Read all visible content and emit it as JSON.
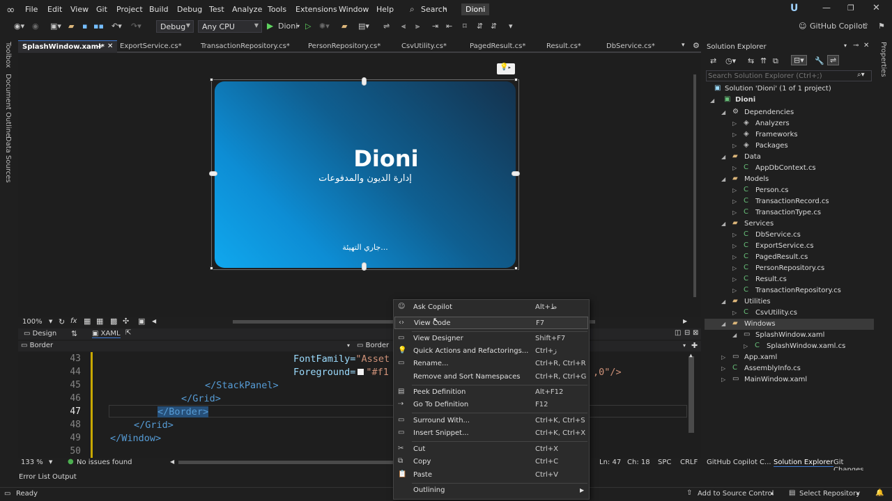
{
  "menu": {
    "items": [
      "File",
      "Edit",
      "View",
      "Git",
      "Project",
      "Build",
      "Debug",
      "Test",
      "Analyze",
      "Tools",
      "Extensions",
      "Window",
      "Help"
    ],
    "search": "Search",
    "solution_name": "Dioni"
  },
  "toolbar": {
    "config": "Debug",
    "platform": "Any CPU",
    "run_target": "Dioni",
    "copilot": "GitHub Copilot"
  },
  "left_rail": [
    "Toolbox",
    "Document Outline",
    "Data Sources"
  ],
  "right_rail": [
    "Properties"
  ],
  "doc_tabs": [
    "SplashWindow.xaml*",
    "ExportService.cs*",
    "TransactionRepository.cs*",
    "PersonRepository.cs*",
    "CsvUtility.cs*",
    "PagedResult.cs*",
    "Result.cs*",
    "DbService.cs*"
  ],
  "splash": {
    "title": "Dioni",
    "subtitle": "إدارة الديون والمدفوعات",
    "loading": "جاري التهيئة..."
  },
  "designer_bar": {
    "zoom": "100%",
    "design_tab": "Design",
    "xaml_tab": "XAML",
    "nav_left": "Border",
    "nav_right": "Border"
  },
  "code": {
    "lines": [
      {
        "num": "43",
        "text_a": "FontFamily=",
        "text_b": "\"Asset"
      },
      {
        "num": "44",
        "text_a": "Foreground=",
        "text_b": "\"#f1"
      },
      {
        "num": "45",
        "text": "</StackPanel>"
      },
      {
        "num": "46",
        "text": "</Grid>"
      },
      {
        "num": "47",
        "text": "</Border>"
      },
      {
        "num": "48",
        "text": "</Grid>"
      },
      {
        "num": "49",
        "text": "</Window>"
      },
      {
        "num": "50",
        "text": ""
      }
    ],
    "tail": ",0\"/>"
  },
  "code_status": {
    "zoom": "133 %",
    "issues": "No issues found",
    "ln": "Ln: 47",
    "ch": "Ch: 18",
    "spc": "SPC",
    "crlf": "CRLF"
  },
  "solution_explorer": {
    "title": "Solution Explorer",
    "search_placeholder": "Search Solution Explorer (Ctrl+;)",
    "solution": "Solution 'Dioni' (1 of 1 project)",
    "project": "Dioni",
    "items": [
      {
        "label": "Dependencies",
        "indent": 2
      },
      {
        "label": "Analyzers",
        "indent": 3
      },
      {
        "label": "Frameworks",
        "indent": 3
      },
      {
        "label": "Packages",
        "indent": 3
      },
      {
        "label": "Data",
        "indent": 2
      },
      {
        "label": "AppDbContext.cs",
        "indent": 3
      },
      {
        "label": "Models",
        "indent": 2
      },
      {
        "label": "Person.cs",
        "indent": 3
      },
      {
        "label": "TransactionRecord.cs",
        "indent": 3
      },
      {
        "label": "TransactionType.cs",
        "indent": 3
      },
      {
        "label": "Services",
        "indent": 2
      },
      {
        "label": "DbService.cs",
        "indent": 3
      },
      {
        "label": "ExportService.cs",
        "indent": 3
      },
      {
        "label": "PagedResult.cs",
        "indent": 3
      },
      {
        "label": "PersonRepository.cs",
        "indent": 3
      },
      {
        "label": "Result.cs",
        "indent": 3
      },
      {
        "label": "TransactionRepository.cs",
        "indent": 3
      },
      {
        "label": "Utilities",
        "indent": 2
      },
      {
        "label": "CsvUtility.cs",
        "indent": 3
      },
      {
        "label": "Windows",
        "indent": 2
      },
      {
        "label": "SplashWindow.xaml",
        "indent": 3
      },
      {
        "label": "SplashWindow.xaml.cs",
        "indent": 4
      },
      {
        "label": "App.xaml",
        "indent": 2
      },
      {
        "label": "AssemblyInfo.cs",
        "indent": 2
      },
      {
        "label": "MainWindow.xaml",
        "indent": 2
      }
    ],
    "bottom_tabs": [
      "GitHub Copilot C...",
      "Solution Explorer",
      "Git Changes"
    ]
  },
  "bottom_tabs": [
    "Error List",
    "Output"
  ],
  "status": {
    "ready": "Ready",
    "source_control": "Add to Source Control",
    "repo": "Select Repository"
  },
  "context_menu": {
    "items": [
      {
        "label": "Ask Copilot",
        "shortcut": "Alt+ط"
      },
      {
        "label": "View Code",
        "shortcut": "F7"
      },
      {
        "label": "View Designer",
        "shortcut": "Shift+F7"
      },
      {
        "label": "Quick Actions and Refactorings...",
        "shortcut": "Ctrl+ز"
      },
      {
        "label": "Rename...",
        "shortcut": "Ctrl+R, Ctrl+R"
      },
      {
        "label": "Remove and Sort Namespaces",
        "shortcut": "Ctrl+R, Ctrl+G"
      },
      {
        "label": "Peek Definition",
        "shortcut": "Alt+F12"
      },
      {
        "label": "Go To Definition",
        "shortcut": "F12"
      },
      {
        "label": "Surround With...",
        "shortcut": "Ctrl+K, Ctrl+S"
      },
      {
        "label": "Insert Snippet...",
        "shortcut": "Ctrl+K, Ctrl+X"
      },
      {
        "label": "Cut",
        "shortcut": "Ctrl+X"
      },
      {
        "label": "Copy",
        "shortcut": "Ctrl+C"
      },
      {
        "label": "Paste",
        "shortcut": "Ctrl+V"
      },
      {
        "label": "Outlining",
        "shortcut": ""
      }
    ]
  }
}
